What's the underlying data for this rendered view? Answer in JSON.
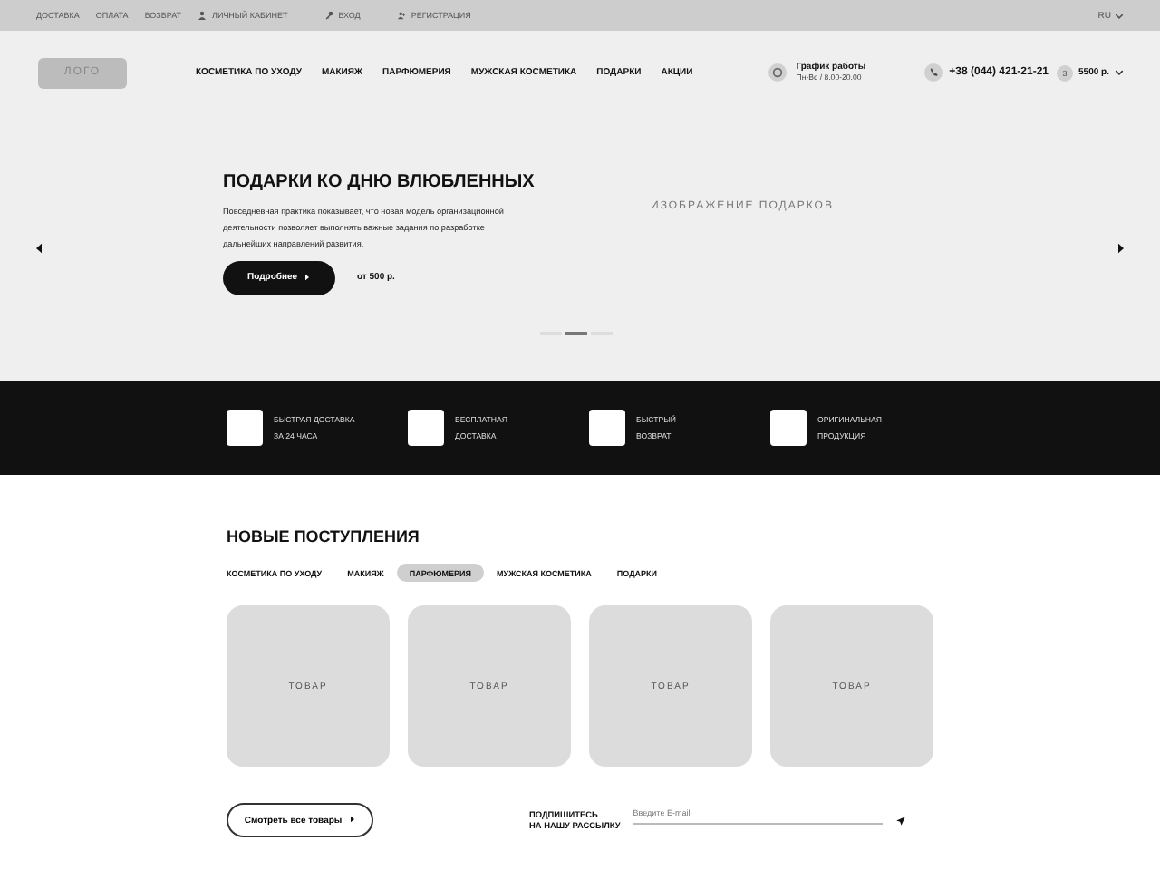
{
  "top_bar": {
    "links": [
      "ДОСТАВКА",
      "ОПЛАТА",
      "ВОЗВРАТ"
    ],
    "account": [
      {
        "kind": "user",
        "label": "ЛИЧНЫЙ КАБИНЕТ"
      },
      {
        "kind": "key",
        "label": "ВХОД"
      },
      {
        "kind": "add-user",
        "label": "РЕГИСТРАЦИЯ"
      }
    ],
    "language": "RU"
  },
  "header": {
    "logo": "ЛОГО",
    "nav": [
      "КОСМЕТИКА ПО УХОДУ",
      "МАКИЯЖ",
      "ПАРФЮМЕРИЯ",
      "МУЖСКАЯ КОСМЕТИКА",
      "ПОДАРКИ",
      "АКЦИИ"
    ],
    "schedule": {
      "title": "График работы",
      "hours": "Пн-Вс / 8.00-20.00"
    },
    "phone": "+38 (044) 421-21-21",
    "cart_count": "3",
    "cart_total": "5500 р."
  },
  "hero": {
    "title": "ПОДАРКИ КО ДНЮ ВЛЮБЛЕННЫХ",
    "text": "Повседневная практика показывает, что новая модель организационной деятельности позволяет выполнять важные задания по разработке дальнейших направлений развития.",
    "button": "Подробнее",
    "price": "от 500 р.",
    "image_label": "ИЗОБРАЖЕНИЕ ПОДАРКОВ",
    "slides": [
      {
        "selected": false
      },
      {
        "selected": true
      },
      {
        "selected": false
      }
    ]
  },
  "features": [
    {
      "text": "БЫСТРАЯ ДОСТАВКА\nЗА 24 ЧАСА"
    },
    {
      "text": "БЕСПЛАТНАЯ\nДОСТАВКА"
    },
    {
      "text": "БЫСТРЫЙ\nВОЗВРАТ"
    },
    {
      "text": "ОРИГИНАЛЬНАЯ\nПРОДУКЦИЯ"
    }
  ],
  "new_arrivals": {
    "title": "НОВЫЕ ПОСТУПЛЕНИЯ",
    "tabs": [
      {
        "label": "КОСМЕТИКА ПО УХОДУ",
        "selected": false
      },
      {
        "label": "МАКИЯЖ",
        "selected": false
      },
      {
        "label": "ПАРФЮМЕРИЯ",
        "selected": true
      },
      {
        "label": "МУЖСКАЯ КОСМЕТИКА",
        "selected": false
      },
      {
        "label": "ПОДАРКИ",
        "selected": false
      }
    ],
    "products": [
      {
        "label": "ТОВАР"
      },
      {
        "label": "ТОВАР"
      },
      {
        "label": "ТОВАР"
      },
      {
        "label": "ТОВАР"
      }
    ],
    "all_button": "Смотреть все товары"
  },
  "subscribe": {
    "label": "ПОДПИШИТЕСЬ\nНА НАШУ РАССЫЛКУ",
    "placeholder": "Введите E-mail"
  }
}
